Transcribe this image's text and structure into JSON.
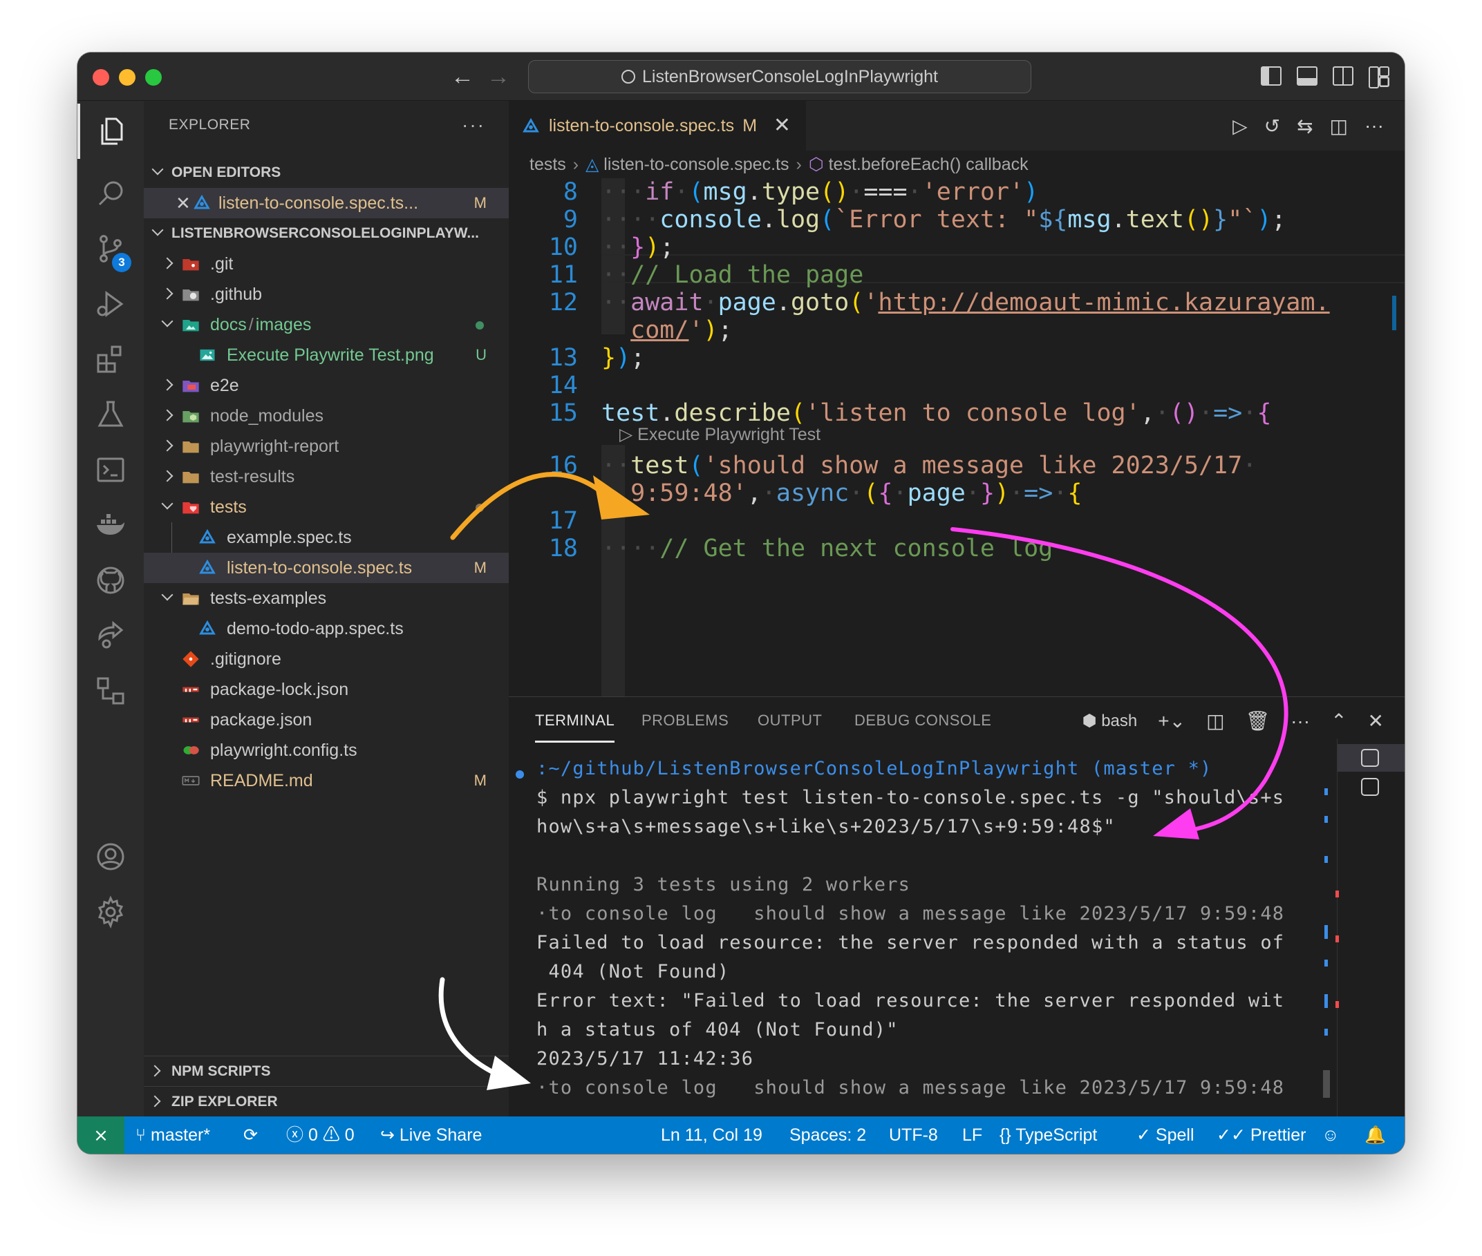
{
  "window": {
    "command_center": "ListenBrowserConsoleLogInPlaywright"
  },
  "activity_bar": {
    "scm_badge": "3"
  },
  "sidebar": {
    "title": "EXPLORER",
    "more": "···",
    "open_editors_title": "OPEN EDITORS",
    "open_editor": {
      "name": "listen-to-console.spec.ts...",
      "status": "M"
    },
    "project_title": "LISTENBROWSERCONSOLELOGINPLAYW...",
    "tree": [
      {
        "name": ".git"
      },
      {
        "name": ".github"
      },
      {
        "name": "docs",
        "sep": "/",
        "name2": "images"
      },
      {
        "name": "Execute Playwrite Test.png",
        "status": "U"
      },
      {
        "name": "e2e"
      },
      {
        "name": "node_modules"
      },
      {
        "name": "playwright-report"
      },
      {
        "name": "test-results"
      },
      {
        "name": "tests"
      },
      {
        "name": "example.spec.ts"
      },
      {
        "name": "listen-to-console.spec.ts",
        "status": "M"
      },
      {
        "name": "tests-examples"
      },
      {
        "name": "demo-todo-app.spec.ts"
      },
      {
        "name": ".gitignore"
      },
      {
        "name": "package-lock.json"
      },
      {
        "name": "package.json"
      },
      {
        "name": "playwright.config.ts"
      },
      {
        "name": "README.md",
        "status": "M"
      }
    ],
    "npm_scripts": "NPM SCRIPTS",
    "zip_explorer": "ZIP EXPLORER"
  },
  "editor": {
    "tab": {
      "name": "listen-to-console.spec.ts",
      "status": "M",
      "close": "✕"
    },
    "breadcrumb": [
      "tests",
      "listen-to-console.spec.ts",
      "test.beforeEach() callback"
    ],
    "line_numbers": [
      "8",
      "9",
      "10",
      "11",
      "12",
      "13",
      "14",
      "15",
      "16",
      "17",
      "18"
    ],
    "codelens": "Execute Playwright Test"
  },
  "panel": {
    "tabs": [
      "TERMINAL",
      "PROBLEMS",
      "OUTPUT",
      "DEBUG CONSOLE"
    ],
    "shell": "bash",
    "terminal_lines": [
      ":~/github/ListenBrowserConsoleLogInPlaywright (master *)",
      "$ npx playwright test listen-to-console.spec.ts -g \"should\\s+s",
      "how\\s+a\\s+message\\s+like\\s+2023/5/17\\s+9:59:48$\"",
      "",
      "Running 3 tests using 2 workers",
      "·to console log   should show a message like 2023/5/17 9:59:48",
      "Failed to load resource: the server responded with a status of",
      " 404 (Not Found)",
      "Error text: \"Failed to load resource: the server responded wit",
      "h a status of 404 (Not Found)\"",
      "2023/5/17 11:42:36",
      "·to console log   should show a message like 2023/5/17 9:59:48"
    ]
  },
  "statusbar": {
    "branch": "master*",
    "errors": "0",
    "warnings": "0",
    "live_share": "Live Share",
    "position": "Ln 11, Col 19",
    "spaces": "Spaces: 2",
    "encoding": "UTF-8",
    "eol": "LF",
    "language": "TypeScript",
    "spell": "Spell",
    "prettier": "Prettier"
  },
  "colors": {
    "accent": "#007acc",
    "modified": "#e2c08d",
    "untracked": "#73c991",
    "arrow_orange": "#f5a623",
    "arrow_magenta": "#ff3df0"
  }
}
